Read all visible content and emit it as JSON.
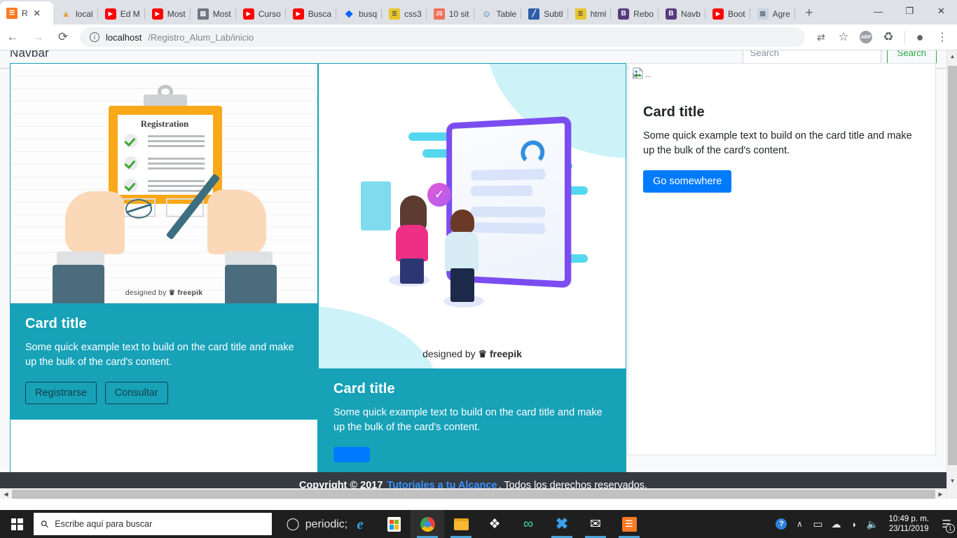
{
  "browser": {
    "tabs": [
      {
        "title": "R",
        "favicon": "xampp-icon",
        "active": true
      },
      {
        "title": "local",
        "favicon": "phpmyadmin-icon",
        "active": false
      },
      {
        "title": "Ed M",
        "favicon": "youtube-icon",
        "active": false
      },
      {
        "title": "Most",
        "favicon": "youtube-icon",
        "active": false
      },
      {
        "title": "Most",
        "favicon": "server-icon",
        "active": false
      },
      {
        "title": "Curso",
        "favicon": "youtube-icon",
        "active": false
      },
      {
        "title": "Busca",
        "favicon": "youtube-icon",
        "active": false
      },
      {
        "title": "busq",
        "favicon": "dropbox-icon",
        "active": false
      },
      {
        "title": "css3",
        "favicon": "w3schools-icon",
        "active": false
      },
      {
        "title": "10 sit",
        "favicon": "js-icon",
        "active": false
      },
      {
        "title": "Table",
        "favicon": "bootstrap-cdn-icon",
        "active": false
      },
      {
        "title": "Subtl",
        "favicon": "subtitle-icon",
        "active": false
      },
      {
        "title": "html",
        "favicon": "w3schools-icon",
        "active": false
      },
      {
        "title": "Rebo",
        "favicon": "bootstrap-icon",
        "active": false
      },
      {
        "title": "Navb",
        "favicon": "bootstrap-icon",
        "active": false
      },
      {
        "title": "Boot",
        "favicon": "youtube-icon",
        "active": false
      },
      {
        "title": "Agre",
        "favicon": "doc-icon",
        "active": false
      }
    ],
    "tab_close_label": "✕",
    "new_tab_label": "+",
    "window_controls": {
      "minimize": "—",
      "maximize": "❐",
      "close": "✕"
    },
    "nav": {
      "back": "←",
      "forward": "→",
      "reload": "⟳"
    },
    "address": {
      "site_info_icon": "info-icon",
      "host": "localhost",
      "path": "/Registro_Alum_Lab/inicio",
      "full_url": "localhost/Registro_Alum_Lab/inicio"
    },
    "toolbar_icons": [
      {
        "name": "translate-icon",
        "glyph": "⇄"
      },
      {
        "name": "bookmark-star-icon",
        "glyph": "☆"
      },
      {
        "name": "adblock-icon",
        "glyph": "ABP"
      },
      {
        "name": "recycle-extension-icon",
        "glyph": "♻"
      },
      {
        "name": "profile-avatar-icon",
        "glyph": "●"
      },
      {
        "name": "chrome-menu-icon",
        "glyph": "⋮"
      }
    ]
  },
  "page": {
    "navbar": {
      "brand": "Navbar",
      "search_placeholder": "Search",
      "search_value": "",
      "search_button": "Search"
    },
    "cards": [
      {
        "id": "card-registro",
        "image_alt": "Registration clipboard illustration",
        "image_caption_prefix": "designed by",
        "image_caption_brand": "freepik",
        "illustration_label": "Registration",
        "title": "Card title",
        "text": "Some quick example text to build on the card title and make up the bulk of the card's content.",
        "buttons": [
          {
            "label": "Registrarse",
            "style": "outline"
          },
          {
            "label": "Consultar",
            "style": "outline"
          }
        ]
      },
      {
        "id": "card-consulta",
        "image_alt": "People registering on a tablet illustration",
        "image_caption_prefix": "designed by",
        "image_caption_brand": "freepik",
        "title": "Card title",
        "text": "Some quick example text to build on the card title and make up the bulk of the card's content.",
        "buttons": [
          {
            "label": "",
            "style": "primary"
          }
        ]
      },
      {
        "id": "card-tercera",
        "image_alt": "...",
        "image_broken": true,
        "title": "Card title",
        "text": "Some quick example text to build on the card title and make up the bulk of the card's content.",
        "buttons": [
          {
            "label": "Go somewhere",
            "style": "primary"
          }
        ]
      }
    ],
    "footer": {
      "prefix": "Copyright © 2017",
      "link": "Tutoriales a tu Alcance",
      "suffix": ". Todos los derechos reservados."
    },
    "scrollbars": {
      "v_up": "▲",
      "v_down": "▼",
      "h_left": "◀",
      "h_right": "▶"
    }
  },
  "colors": {
    "card_accent": "#17a2b8",
    "primary_button": "#007bff",
    "footer_bg": "#343a40",
    "footer_link": "#3a91ff",
    "navbar_search_button_border": "#28a745"
  },
  "taskbar": {
    "start_label": "start-icon",
    "search_placeholder": "Escribe aquí para buscar",
    "search_value": "",
    "apps": [
      {
        "name": "cortana-icon",
        "glyph": "○"
      },
      {
        "name": "task-view-icon",
        "glyph": "⌸"
      },
      {
        "name": "edge-icon",
        "glyph": "e"
      },
      {
        "name": "microsoft-store-icon",
        "glyph": "⊞"
      },
      {
        "name": "chrome-icon",
        "glyph": "◉"
      },
      {
        "name": "file-explorer-icon",
        "glyph": "὜0"
      },
      {
        "name": "dropbox-icon",
        "glyph": "❖"
      },
      {
        "name": "infinity-app-icon",
        "glyph": "∞"
      },
      {
        "name": "vscode-icon",
        "glyph": "✕"
      },
      {
        "name": "mail-icon",
        "glyph": "✉"
      },
      {
        "name": "xampp-icon",
        "glyph": "⌧"
      }
    ],
    "tray": [
      {
        "name": "help-question-icon",
        "glyph": "?"
      },
      {
        "name": "show-hidden-icons-chevron",
        "glyph": "∧"
      },
      {
        "name": "battery-icon",
        "glyph": "▭"
      },
      {
        "name": "onedrive-cloud-icon",
        "glyph": "☁"
      },
      {
        "name": "wifi-icon",
        "glyph": "◠"
      },
      {
        "name": "volume-icon",
        "glyph": "ὐa"
      }
    ],
    "clock": {
      "time": "10:49 p. m.",
      "date": "23/11/2019"
    },
    "notifications": {
      "icon": "action-center-icon",
      "count": "1"
    }
  }
}
